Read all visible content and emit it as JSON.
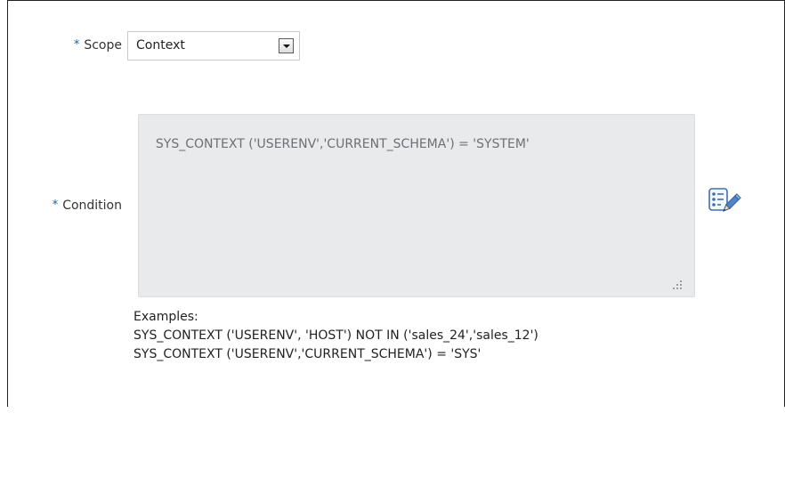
{
  "scope": {
    "label": "Scope",
    "required_marker": "*",
    "selected": "Context"
  },
  "condition": {
    "label": "Condition",
    "required_marker": "*",
    "value": "SYS_CONTEXT ('USERENV','CURRENT_SCHEMA') = 'SYSTEM'"
  },
  "examples": {
    "heading": "Examples:",
    "lines": [
      "SYS_CONTEXT ('USERENV', 'HOST') NOT IN ('sales_24','sales_12')",
      "SYS_CONTEXT ('USERENV','CURRENT_SCHEMA') = 'SYS'"
    ]
  },
  "icons": {
    "dropdown": "chevron-down-icon",
    "edit_condition": "condition-builder-edit-icon"
  },
  "colors": {
    "required": "#1a5fa0",
    "textarea_bg": "#e9eaeb",
    "text": "#333333"
  }
}
